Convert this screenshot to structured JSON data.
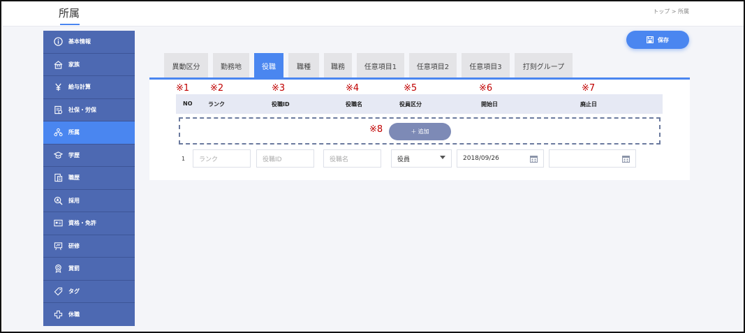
{
  "header": {
    "title": "所属",
    "breadcrumb": "トップ > 所属"
  },
  "sidebar": {
    "items": [
      {
        "label": "基本情報",
        "icon": "info-icon"
      },
      {
        "label": "家族",
        "icon": "family-icon"
      },
      {
        "label": "給与計算",
        "icon": "payroll-icon"
      },
      {
        "label": "社保・労保",
        "icon": "insurance-icon"
      },
      {
        "label": "所属",
        "icon": "organization-icon",
        "active": true
      },
      {
        "label": "学歴",
        "icon": "graduation-cap-icon"
      },
      {
        "label": "職歴",
        "icon": "work-history-icon"
      },
      {
        "label": "採用",
        "icon": "recruit-search-icon"
      },
      {
        "label": "資格・免許",
        "icon": "license-icon"
      },
      {
        "label": "研修",
        "icon": "training-board-icon"
      },
      {
        "label": "賞罰",
        "icon": "award-medal-icon"
      },
      {
        "label": "タグ",
        "icon": "tag-icon"
      },
      {
        "label": "休職",
        "icon": "cross-icon"
      }
    ]
  },
  "toolbar": {
    "save_label": "保存"
  },
  "tabs": [
    {
      "label": "異動区分"
    },
    {
      "label": "勤務地"
    },
    {
      "label": "役職",
      "active": true
    },
    {
      "label": "職種"
    },
    {
      "label": "職務"
    },
    {
      "label": "任意項目1"
    },
    {
      "label": "任意項目2"
    },
    {
      "label": "任意項目3"
    },
    {
      "label": "打刻グループ"
    }
  ],
  "annotations": [
    "※1",
    "※2",
    "※3",
    "※4",
    "※5",
    "※6",
    "※7",
    "※8"
  ],
  "table": {
    "columns": [
      "NO",
      "ランク",
      "役職ID",
      "役職名",
      "役員区分",
      "開始日",
      "廃止日"
    ],
    "add_label": "＋ 追加",
    "row": {
      "no": "1",
      "rank_placeholder": "ランク",
      "id_placeholder": "役職ID",
      "name_placeholder": "役職名",
      "officer_type": "役員",
      "start_date": "2018/09/26",
      "end_date": ""
    }
  },
  "colors": {
    "accent": "#4a86f0",
    "sidebar": "#4d69b2",
    "annotation": "#c00000"
  }
}
